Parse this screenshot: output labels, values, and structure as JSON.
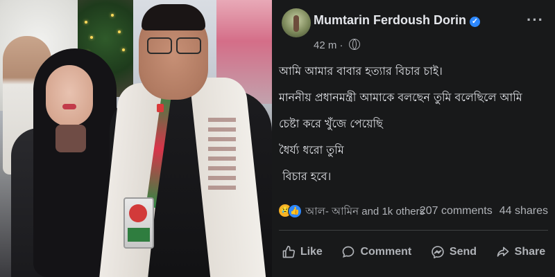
{
  "post": {
    "author_name": "Mumtarin Ferdoush Dorin",
    "verified_badge": "✓",
    "time": "42 m",
    "separator": "·",
    "privacy_icon": "globe-icon",
    "more_label": "···",
    "lines": [
      "আমি আমার বাবার হত্যার বিচার চাই।",
      "মাননীয় প্রধানমন্ত্রী আমাকে বলছেন তুমি বলেছিলে আমি",
      "চেষ্টা করে খুঁজে পেয়েছি",
      "ধৈর্য্য ধরো তুমি",
      " বিচার হবে।"
    ],
    "reactions": {
      "icons": [
        "sad-reaction-icon",
        "like-reaction-icon"
      ],
      "sad_glyph": "😢",
      "like_glyph": "👍",
      "label": "আল- আমিন and 1k others"
    },
    "comments_count": "207 comments",
    "shares_count": "44 shares",
    "actions": [
      {
        "label": "Like",
        "icon": "thumbs-up-icon"
      },
      {
        "label": "Comment",
        "icon": "comment-bubble-icon"
      },
      {
        "label": "Send",
        "icon": "messenger-icon"
      },
      {
        "label": "Share",
        "icon": "share-arrow-icon"
      }
    ]
  },
  "colors": {
    "post_background": "#18191a",
    "text_primary": "#e4e6eb",
    "text_secondary": "#b0b3b8",
    "verified_blue": "#2d88ff",
    "divider": "#3e4042"
  }
}
